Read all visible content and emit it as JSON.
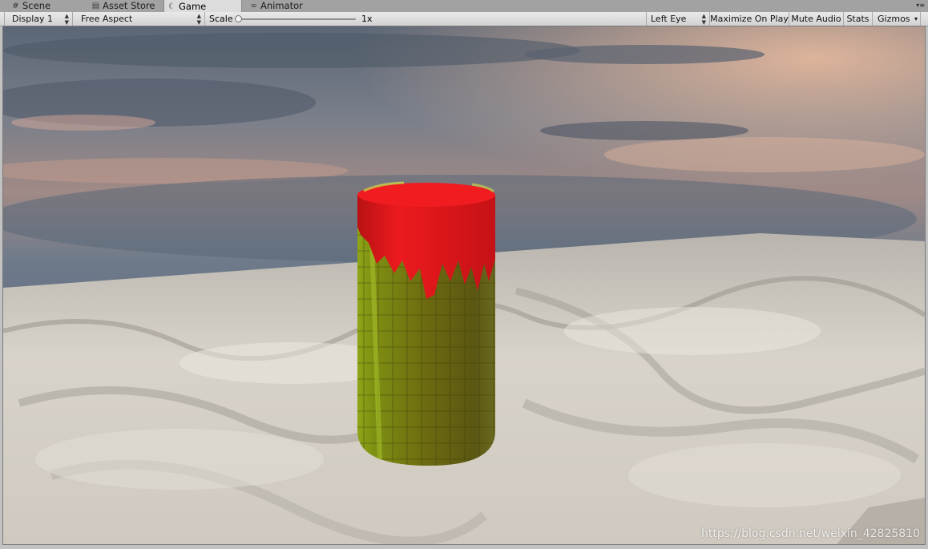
{
  "tabs": [
    {
      "label": "Scene",
      "icon": "grid-icon",
      "active": false
    },
    {
      "label": "Asset Store",
      "icon": "store-icon",
      "active": false
    },
    {
      "label": "Game",
      "icon": "game-icon",
      "active": true
    },
    {
      "label": "Animator",
      "icon": "animator-icon",
      "active": false
    }
  ],
  "toolbar": {
    "display": "Display 1",
    "aspect": "Free Aspect",
    "scale_label": "Scale",
    "scale_value": "1x",
    "eye": "Left Eye",
    "maximize": "Maximize On Play",
    "mute": "Mute Audio",
    "stats": "Stats",
    "gizmos": "Gizmos"
  },
  "viewport": {
    "watermark": "https://blog.csdn.net/weixin_42825810"
  },
  "colors": {
    "tab_bar": "#a2a2a2",
    "active_tab": "#dcdcdc",
    "toolbar": "#dedede",
    "cylinder_top": "#e5141a",
    "cylinder_body": "#6f6f12",
    "floor": "#d6d0c6"
  }
}
